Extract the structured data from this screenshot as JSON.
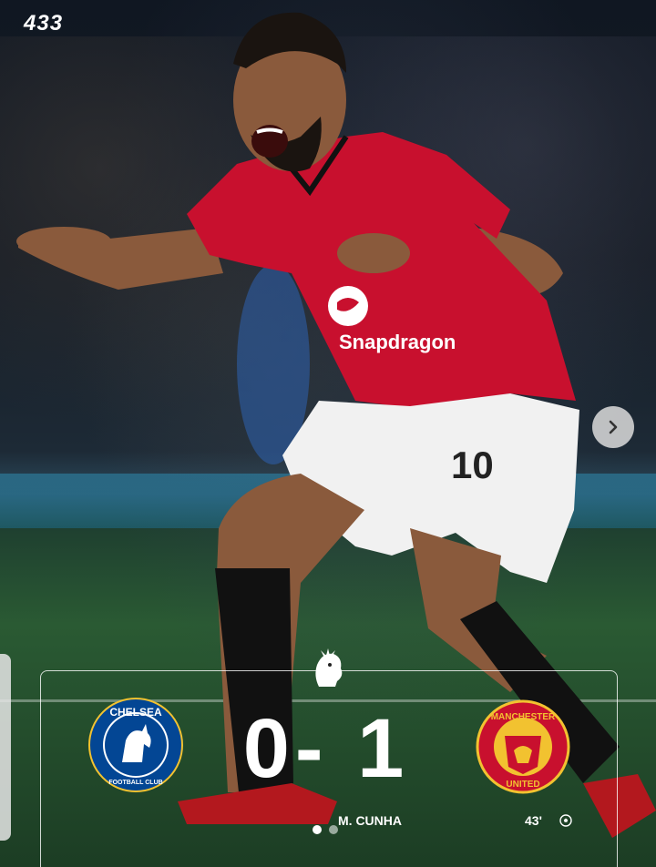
{
  "brand": {
    "logo_text": "433"
  },
  "match": {
    "home_team": "CHELSEA",
    "home_sub": "FOOTBALL CLUB",
    "away_team_top": "MANCHESTER",
    "away_team_bottom": "UNITED",
    "score": "0- 1",
    "scorer": "M. CUNHA",
    "minute": "43'"
  },
  "player": {
    "shirt_number": "10",
    "sponsor": "Snapdragon"
  },
  "carousel": {
    "slides": 2,
    "active_index": 0
  },
  "colors": {
    "united_red": "#c8102e",
    "chelsea_blue": "#034694",
    "gold": "#f2c230"
  }
}
